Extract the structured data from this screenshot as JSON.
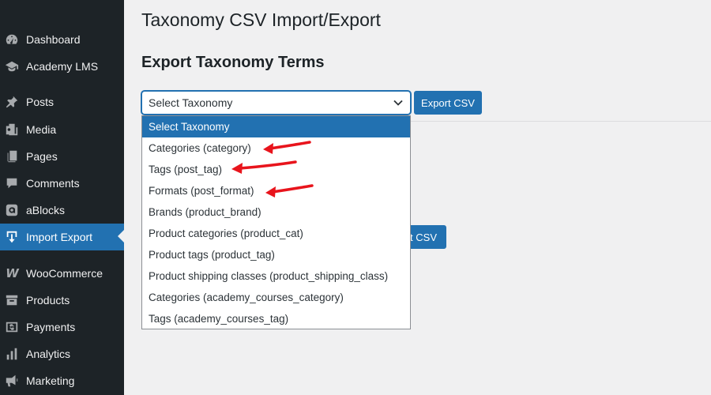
{
  "sidebar": {
    "items": [
      {
        "label": "Dashboard",
        "icon": "dashboard-icon"
      },
      {
        "label": "Academy LMS",
        "icon": "graduation-cap-icon"
      },
      {
        "label": "Posts",
        "icon": "pin-icon"
      },
      {
        "label": "Media",
        "icon": "media-icon"
      },
      {
        "label": "Pages",
        "icon": "pages-icon"
      },
      {
        "label": "Comments",
        "icon": "comment-icon"
      },
      {
        "label": "aBlocks",
        "icon": "ablocks-icon"
      },
      {
        "label": "Import Export",
        "icon": "import-export-icon",
        "active": true
      },
      {
        "label": "WooCommerce",
        "icon": "woocommerce-icon"
      },
      {
        "label": "Products",
        "icon": "archive-icon"
      },
      {
        "label": "Payments",
        "icon": "payments-icon"
      },
      {
        "label": "Analytics",
        "icon": "chart-bar-icon"
      },
      {
        "label": "Marketing",
        "icon": "megaphone-icon"
      }
    ]
  },
  "main": {
    "page_title": "Taxonomy CSV Import/Export",
    "section_title": "Export Taxonomy Terms",
    "select_value": "Select Taxonomy",
    "export_button": "Export CSV",
    "second_button": "rt CSV"
  },
  "dropdown": {
    "options": [
      "Select Taxonomy",
      "Categories (category)",
      "Tags (post_tag)",
      "Formats (post_format)",
      "Brands (product_brand)",
      "Product categories (product_cat)",
      "Product tags (product_tag)",
      "Product shipping classes (product_shipping_class)",
      "Categories (academy_courses_category)",
      "Tags (academy_courses_tag)"
    ],
    "selected_index": 0
  },
  "colors": {
    "sidebar_bg": "#1d2327",
    "accent": "#2271b1",
    "annotation_arrow": "#e8141c"
  }
}
